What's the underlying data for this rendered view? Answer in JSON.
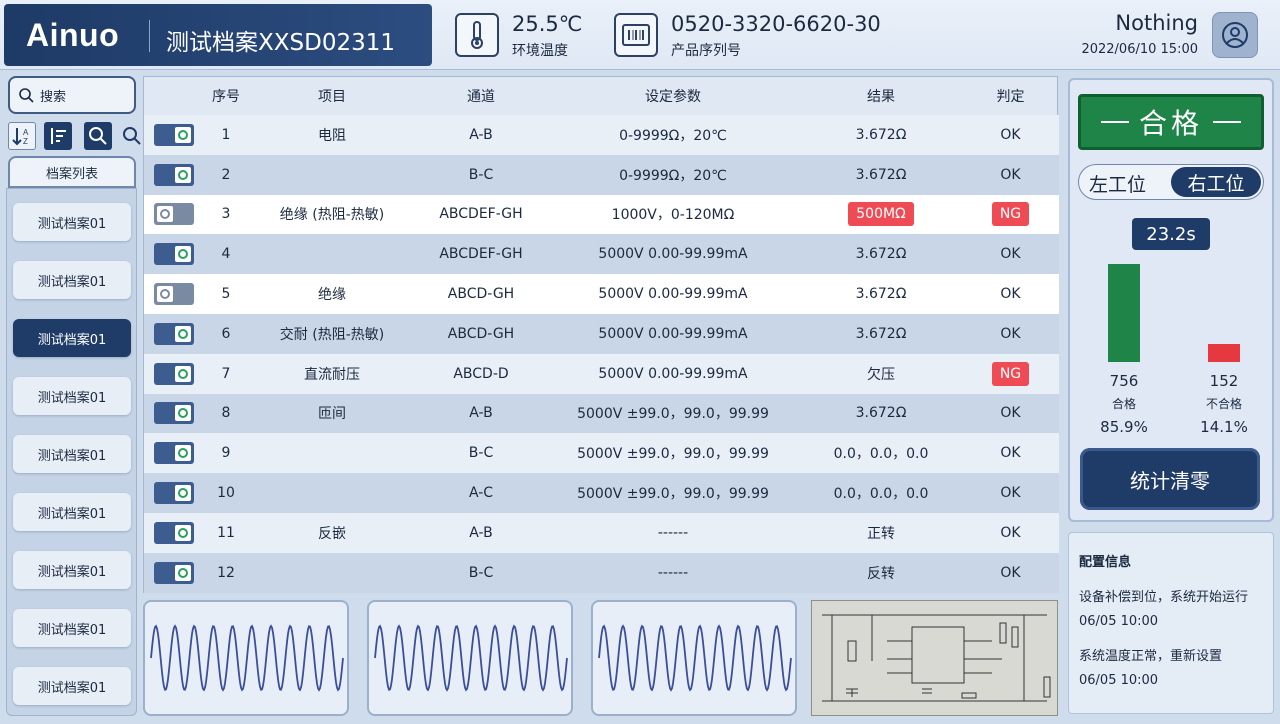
{
  "header": {
    "brand": "Ainuo",
    "file_title": "测试档案XXSD02311",
    "temperature_value": "25.5℃",
    "temperature_label": "环境温度",
    "serial_value": "0520-3320-6620-30",
    "serial_label": "产品序列号",
    "user_name": "Nothing",
    "datetime": "2022/06/10 15:00"
  },
  "sidebar": {
    "search_label": "搜索",
    "list_title": "档案列表",
    "items": [
      "测试档案01",
      "测试档案01",
      "测试档案01",
      "测试档案01",
      "测试档案01",
      "测试档案01",
      "测试档案01",
      "测试档案01",
      "测试档案01"
    ],
    "active_index": 2
  },
  "table": {
    "headers": [
      "",
      "序号",
      "项目",
      "通道",
      "设定参数",
      "结果",
      "判定"
    ],
    "rows": [
      {
        "on": true,
        "no": "1",
        "item": "电阻",
        "channel": "A-B",
        "param": "0-9999Ω，20℃",
        "result": "3.672Ω",
        "result_ng": false,
        "judge": "OK",
        "judge_ng": false
      },
      {
        "on": true,
        "no": "2",
        "item": "",
        "channel": "B-C",
        "param": "0-9999Ω，20℃",
        "result": "3.672Ω",
        "result_ng": false,
        "judge": "OK",
        "judge_ng": false
      },
      {
        "on": false,
        "no": "3",
        "item": "绝缘 (热阻-热敏)",
        "channel": "ABCDEF-GH",
        "param": "1000V，0-120MΩ",
        "result": "500MΩ",
        "result_ng": true,
        "judge": "NG",
        "judge_ng": true
      },
      {
        "on": true,
        "no": "4",
        "item": "",
        "channel": "ABCDEF-GH",
        "param": "5000V 0.00-99.99mA",
        "result": "3.672Ω",
        "result_ng": false,
        "judge": "OK",
        "judge_ng": false
      },
      {
        "on": false,
        "no": "5",
        "item": "绝缘",
        "channel": "ABCD-GH",
        "param": "5000V 0.00-99.99mA",
        "result": "3.672Ω",
        "result_ng": false,
        "judge": "OK",
        "judge_ng": false
      },
      {
        "on": true,
        "no": "6",
        "item": "交耐 (热阻-热敏)",
        "channel": "ABCD-GH",
        "param": "5000V 0.00-99.99mA",
        "result": "3.672Ω",
        "result_ng": false,
        "judge": "OK",
        "judge_ng": false
      },
      {
        "on": true,
        "no": "7",
        "item": "直流耐压",
        "channel": "ABCD-D",
        "param": "5000V 0.00-99.99mA",
        "result": "欠压",
        "result_ng": false,
        "judge": "NG",
        "judge_ng": true
      },
      {
        "on": true,
        "no": "8",
        "item": "匝间",
        "channel": "A-B",
        "param": "5000V ±99.0，99.0，99.99",
        "result": "3.672Ω",
        "result_ng": false,
        "judge": "OK",
        "judge_ng": false
      },
      {
        "on": true,
        "no": "9",
        "item": "",
        "channel": "B-C",
        "param": "5000V ±99.0，99.0，99.99",
        "result": "0.0，0.0，0.0",
        "result_ng": false,
        "judge": "OK",
        "judge_ng": false
      },
      {
        "on": true,
        "no": "10",
        "item": "",
        "channel": "A-C",
        "param": "5000V ±99.0，99.0，99.99",
        "result": "0.0，0.0，0.0",
        "result_ng": false,
        "judge": "OK",
        "judge_ng": false
      },
      {
        "on": true,
        "no": "11",
        "item": "反嵌",
        "channel": "A-B",
        "param": "------",
        "result": "正转",
        "result_ng": false,
        "judge": "OK",
        "judge_ng": false
      },
      {
        "on": true,
        "no": "12",
        "item": "",
        "channel": "B-C",
        "param": "------",
        "result": "反转",
        "result_ng": false,
        "judge": "OK",
        "judge_ng": false
      }
    ]
  },
  "stats": {
    "result_badge": "合格",
    "station_left": "左工位",
    "station_right": "右工位",
    "timer": "23.2s",
    "pass_count": "756",
    "pass_label": "合格",
    "pass_pct": "85.9%",
    "fail_count": "152",
    "fail_label": "不合格",
    "fail_pct": "14.1%",
    "reset_label": "统计清零"
  },
  "config": {
    "title": "配置信息",
    "entries": [
      {
        "msg": "设备补偿到位，系统开始运行",
        "time": "06/05 10:00"
      },
      {
        "msg": "系统温度正常，重新设置",
        "time": "06/05 10:00"
      }
    ]
  },
  "colors": {
    "navy": "#1f3b67",
    "pass_green": "#1e8448",
    "fail_red": "#e5393f",
    "ng_tag": "#ef4b55"
  }
}
